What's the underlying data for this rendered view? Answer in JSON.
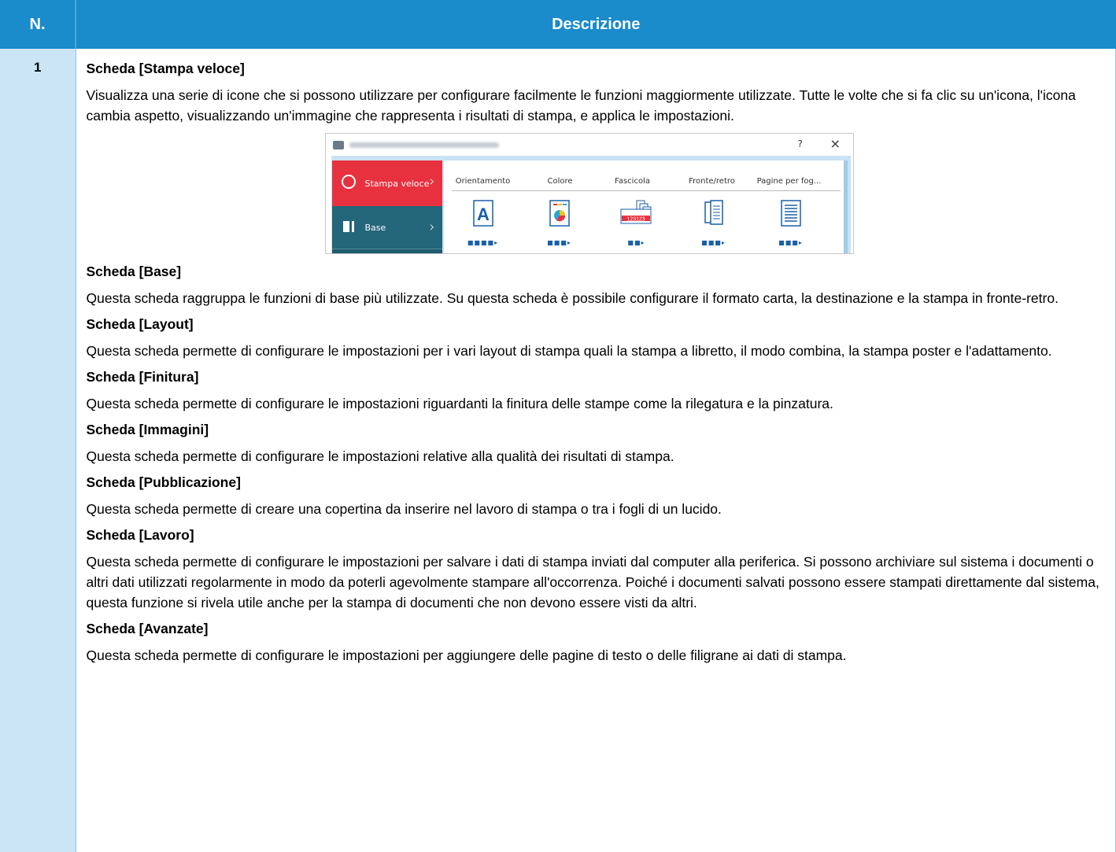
{
  "header": {
    "col_num": "N.",
    "col_desc": "Descrizione"
  },
  "row": {
    "number": "1",
    "sections": [
      {
        "title": "Scheda [Stampa veloce]",
        "body": "Visualizza una serie di icone che si possono utilizzare per configurare facilmente le funzioni maggiormente utilizzate. Tutte le volte che si fa clic su un'icona, l'icona cambia aspetto, visualizzando un'immagine che rappresenta i risultati di stampa, e applica le impostazioni."
      },
      {
        "title": "Scheda [Base]",
        "body": "Questa scheda raggruppa le funzioni di base più utilizzate. Su questa scheda è possibile configurare il formato carta, la destinazione e la stampa in fronte-retro."
      },
      {
        "title": "Scheda [Layout]",
        "body": "Questa scheda permette di configurare le impostazioni per i vari layout di stampa quali la stampa a libretto, il modo combina, la stampa poster e l'adattamento."
      },
      {
        "title": "Scheda [Finitura]",
        "body": "Questa scheda permette di configurare le impostazioni riguardanti la finitura delle stampe come la rilegatura e la pinzatura."
      },
      {
        "title": "Scheda [Immagini]",
        "body": "Questa scheda permette di configurare le impostazioni relative alla qualità dei risultati di stampa."
      },
      {
        "title": "Scheda [Pubblicazione]",
        "body": "Questa scheda permette di creare una copertina da inserire nel lavoro di stampa o tra i fogli di un lucido."
      },
      {
        "title": "Scheda [Lavoro]",
        "body": "Questa scheda permette di configurare le impostazioni per salvare i dati di stampa inviati dal computer alla periferica. Si possono archiviare sul sistema i documenti o altri dati utilizzati regolarmente in modo da poterli agevolmente stampare all'occorrenza. Poiché i documenti salvati possono essere stampati direttamente dal sistema, questa funzione si rivela utile anche per la stampa di documenti che non devono essere visti da altri."
      },
      {
        "title": "Scheda [Avanzate]",
        "body": "Questa scheda permette di configurare le impostazioni per aggiungere delle pagine di testo o delle filigrane ai dati di stampa."
      }
    ]
  },
  "dialog": {
    "help": "?",
    "close": "×",
    "tabs": {
      "quick": "Stampa veloce",
      "base": "Base"
    },
    "columns": [
      "Orientamento",
      "Colore",
      "Fascicola",
      "Fronte/retro",
      "Pagine per fog..."
    ],
    "orientation_letter": "A",
    "collate_label": "123123",
    "accent_red": "#e8313f",
    "accent_teal": "#24667a",
    "accent_blue": "#1a5fa8",
    "header_blue": "#1a8bcb"
  }
}
